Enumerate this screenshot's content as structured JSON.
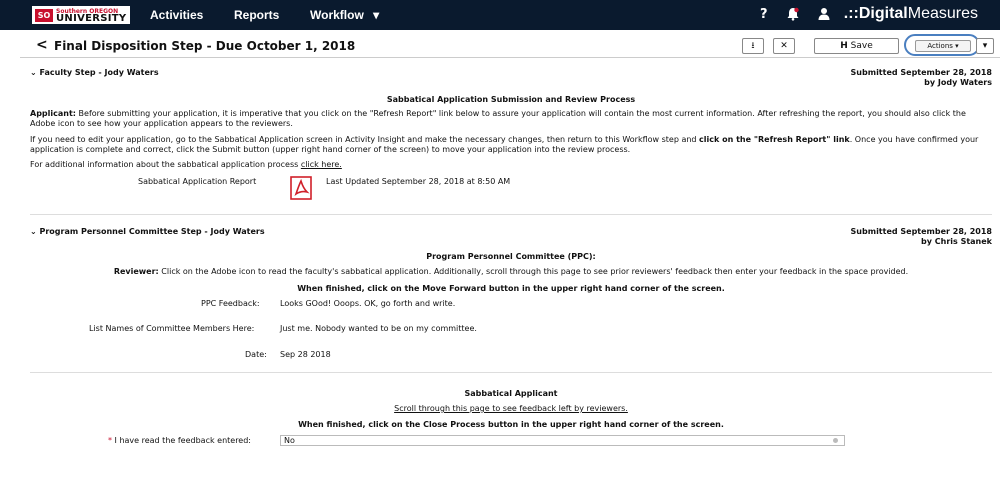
{
  "nav": {
    "logo_badge": "SO",
    "logo_line1": "Southern OREGON",
    "logo_line2": "UNIVERSITY",
    "activities": "Activities",
    "reports": "Reports",
    "workflow": "Workflow",
    "workflow_caret": "▾",
    "help": "?",
    "brand_prefix": ".::",
    "brand_bold": "Digital",
    "brand_thin": "Measures"
  },
  "titlebar": {
    "back": "<",
    "title": "Final Disposition Step - Due October 1, 2018",
    "download_icon": "⭳",
    "close_icon": "✕",
    "save": "Save",
    "save_icon": "H",
    "actions": "Actions ▾",
    "more": "▾"
  },
  "faculty": {
    "heading": "Faculty Step - Jody Waters",
    "caret": "⌄",
    "submitted_line1": "Submitted September 28, 2018",
    "submitted_line2": "by Jody Waters",
    "title": "Sabbatical Application Submission and Review Process",
    "p1_label": "Applicant:",
    "p1_text": " Before submitting your application, it is imperative that you click on the \"Refresh Report\" link below to assure your application will contain the most current information. After refreshing the report, you should also click the Adobe icon to see how your application appears to the reviewers.",
    "p2_a": "If you need to edit your application, go to the Sabbatical Application screen in Activity Insight and make the necessary changes, then return to this Workflow step and ",
    "p2_bold": "click on the \"Refresh Report\" link",
    "p2_b": ". Once you have confirmed your application is complete and correct, click the Submit button (upper right hand corner of the screen) to move your application into the review process.",
    "p3_a": "For additional information about the sabbatical application process ",
    "p3_link": "click here.",
    "report_label": "Sabbatical Application Report",
    "report_updated": "Last Updated September 28, 2018 at 8:50 AM"
  },
  "ppc": {
    "heading": "Program Personnel Committee Step - Jody Waters",
    "caret": "⌄",
    "submitted_line1": "Submitted September 28, 2018",
    "submitted_line2": "by Chris Stanek",
    "title": "Program Personnel Committee (PPC):",
    "reviewer_label": "Reviewer:",
    "reviewer_text": " Click on the Adobe icon to read the faculty's sabbatical application. Additionally, scroll through this page to see prior reviewers' feedback then enter your feedback in the space provided.",
    "instruction": "When finished, click on the Move Forward button in the upper right hand corner of the screen.",
    "feedback_label": "PPC Feedback:",
    "feedback_value": "Looks GOod! Ooops. OK, go forth and write.",
    "members_label": "List Names of Committee Members Here:",
    "members_value": "Just me. Nobody wanted to be on my committee.",
    "date_label": "Date:",
    "date_value": "Sep 28 2018"
  },
  "applicant": {
    "title": "Sabbatical Applicant",
    "scroll_text": "Scroll through this page to see feedback left by reviewers.",
    "instruction": "When finished, click on the Close Process button in the upper right hand corner of the screen.",
    "required_mark": "*",
    "read_label": "I have read the feedback entered:",
    "read_value": "No"
  },
  "colors": {
    "nav_bg": "#0a1a2e",
    "accent_red": "#c8102e",
    "actions_highlight": "#4a7fc0",
    "pdf_red": "#d0202a"
  },
  "icons": [
    "download-icon",
    "close-icon",
    "save-icon",
    "bell-icon",
    "user-icon",
    "help-icon",
    "pdf-icon",
    "caret-icon"
  ]
}
